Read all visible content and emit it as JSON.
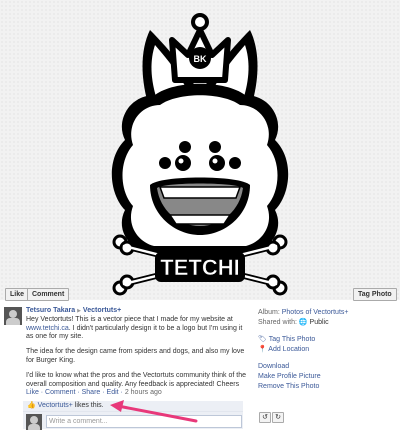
{
  "photo_actions": {
    "like": "Like",
    "comment": "Comment",
    "tag_photo": "Tag Photo"
  },
  "logo": {
    "word": "TETCHI",
    "badge": "BK"
  },
  "post": {
    "author": "Tetsuro Takara",
    "separator": "▶",
    "target": "Vectortuts+",
    "paragraph1_a": "Hey Vectortuts! This is a vector piece that I made for my website at",
    "paragraph1_link": "www.tetchi.ca",
    "paragraph1_b": ". I didn't particularly design it to be a logo but I'm using it as one for my site.",
    "paragraph2": "The idea for the design came from spiders and dogs, and also my love for Burger King.",
    "paragraph3": "I'd like to know what the pros and the Vectortuts community think of the overall composition and quality. Any feedback is appreciated! Cheers",
    "actions": "Like · Comment · Share · Edit ·",
    "time": "2 hours ago"
  },
  "likes": {
    "who": "Vectortuts+",
    "suffix": " likes this."
  },
  "comment": {
    "placeholder": "Write a comment..."
  },
  "sidebar": {
    "album_label": "Album:",
    "album_name": "Photos of Vectortuts+",
    "shared_label": "Shared with:",
    "shared_value": "Public",
    "tag_photo": "Tag This Photo",
    "add_location": "Add Location",
    "download": "Download",
    "make_profile": "Make Profile Picture",
    "remove": "Remove This Photo"
  },
  "colors": {
    "link": "#3b5998",
    "arrow": "#e8387a",
    "likes_bg": "#eceff5"
  }
}
